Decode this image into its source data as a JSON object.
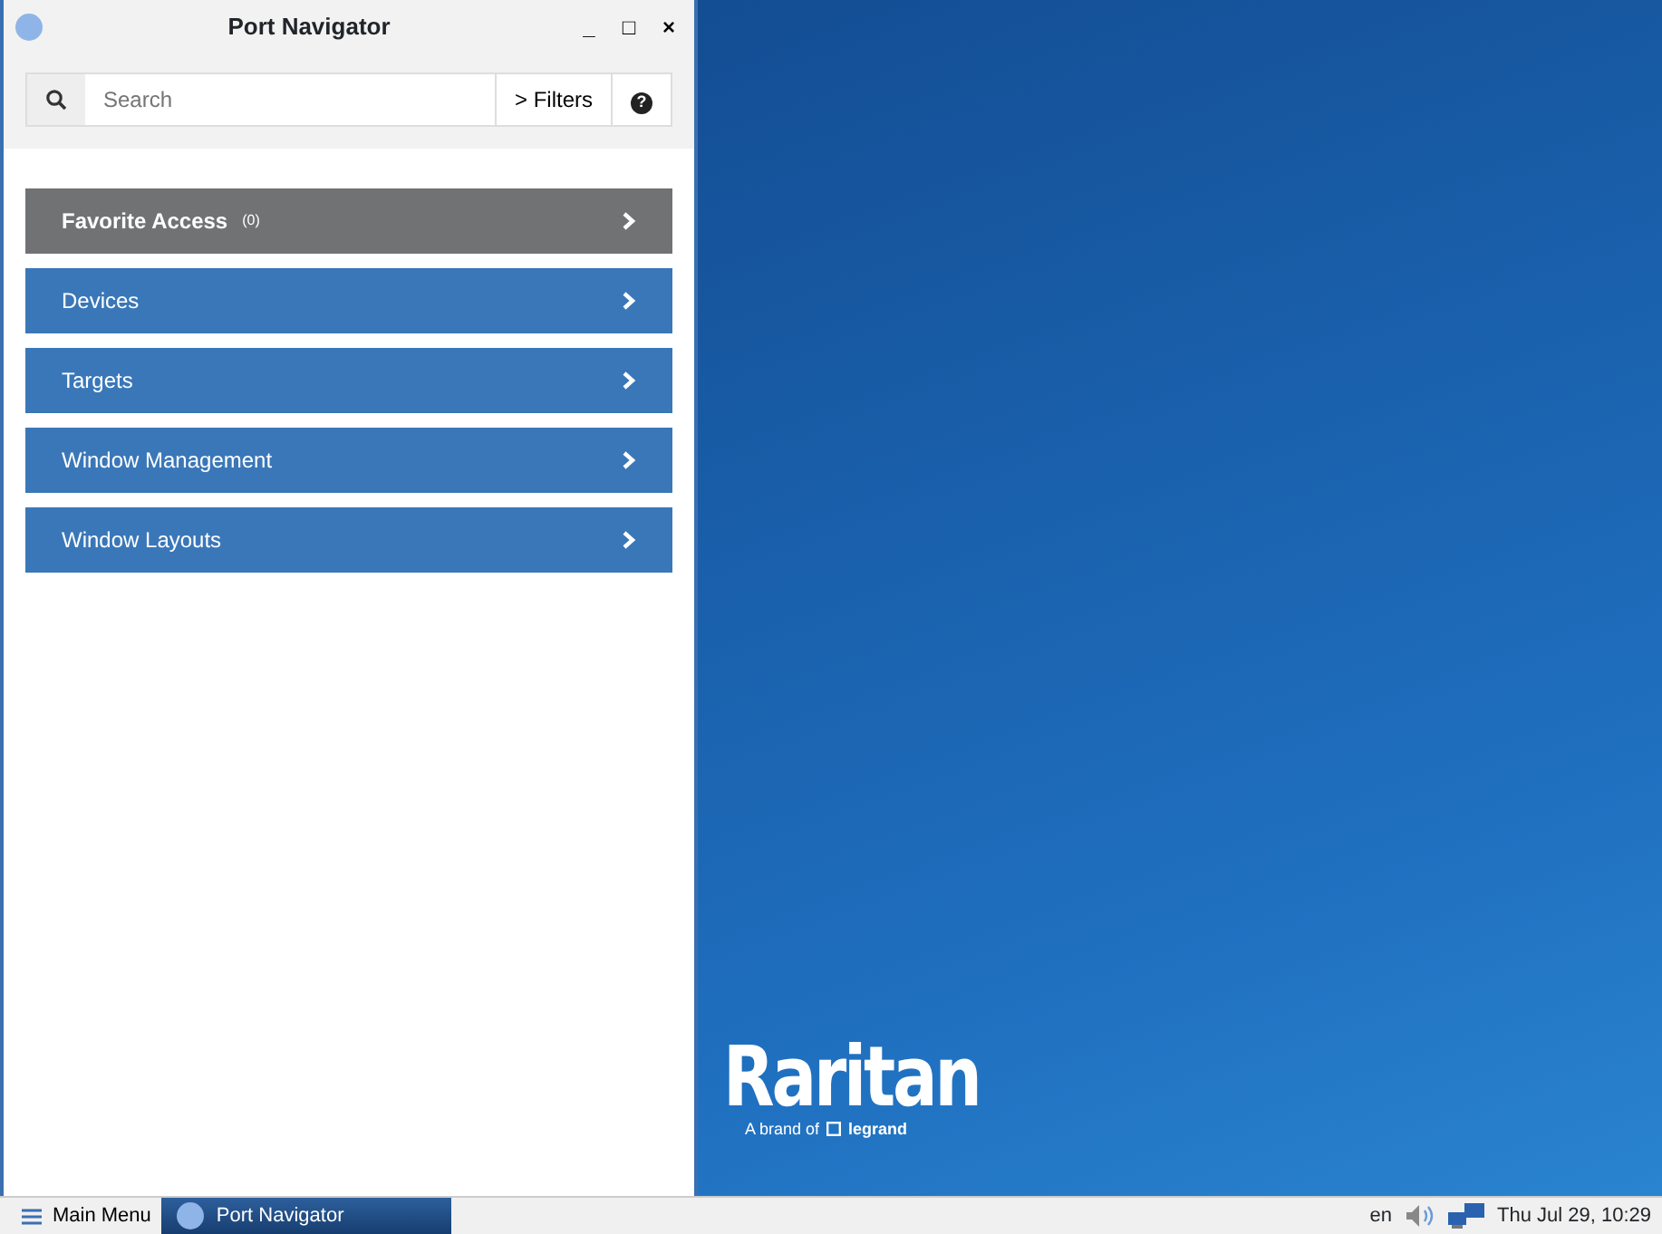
{
  "window": {
    "title": "Port Navigator",
    "controls": [
      "_",
      "□",
      "×"
    ]
  },
  "search": {
    "placeholder": "Search"
  },
  "filters_button": {
    "icon": ">",
    "label": "Filters"
  },
  "help_button": {
    "icon": "?"
  },
  "menu": [
    {
      "label": "Favorite Access",
      "count": "(0)",
      "kind": "favorites"
    },
    {
      "label": "Devices",
      "kind": "category"
    },
    {
      "label": "Targets",
      "kind": "category"
    },
    {
      "label": "Window Management",
      "kind": "category"
    },
    {
      "label": "Window Layouts",
      "kind": "category"
    }
  ],
  "desktop": {
    "logo": "Raritan",
    "tagline": "A brand of",
    "brand": "legrand"
  },
  "taskbar": {
    "main_menu": "Main Menu",
    "tasks": [
      {
        "label": "Port Navigator",
        "selected": true
      }
    ],
    "language": "en",
    "clock": "Thu Jul 29, 10:29"
  }
}
